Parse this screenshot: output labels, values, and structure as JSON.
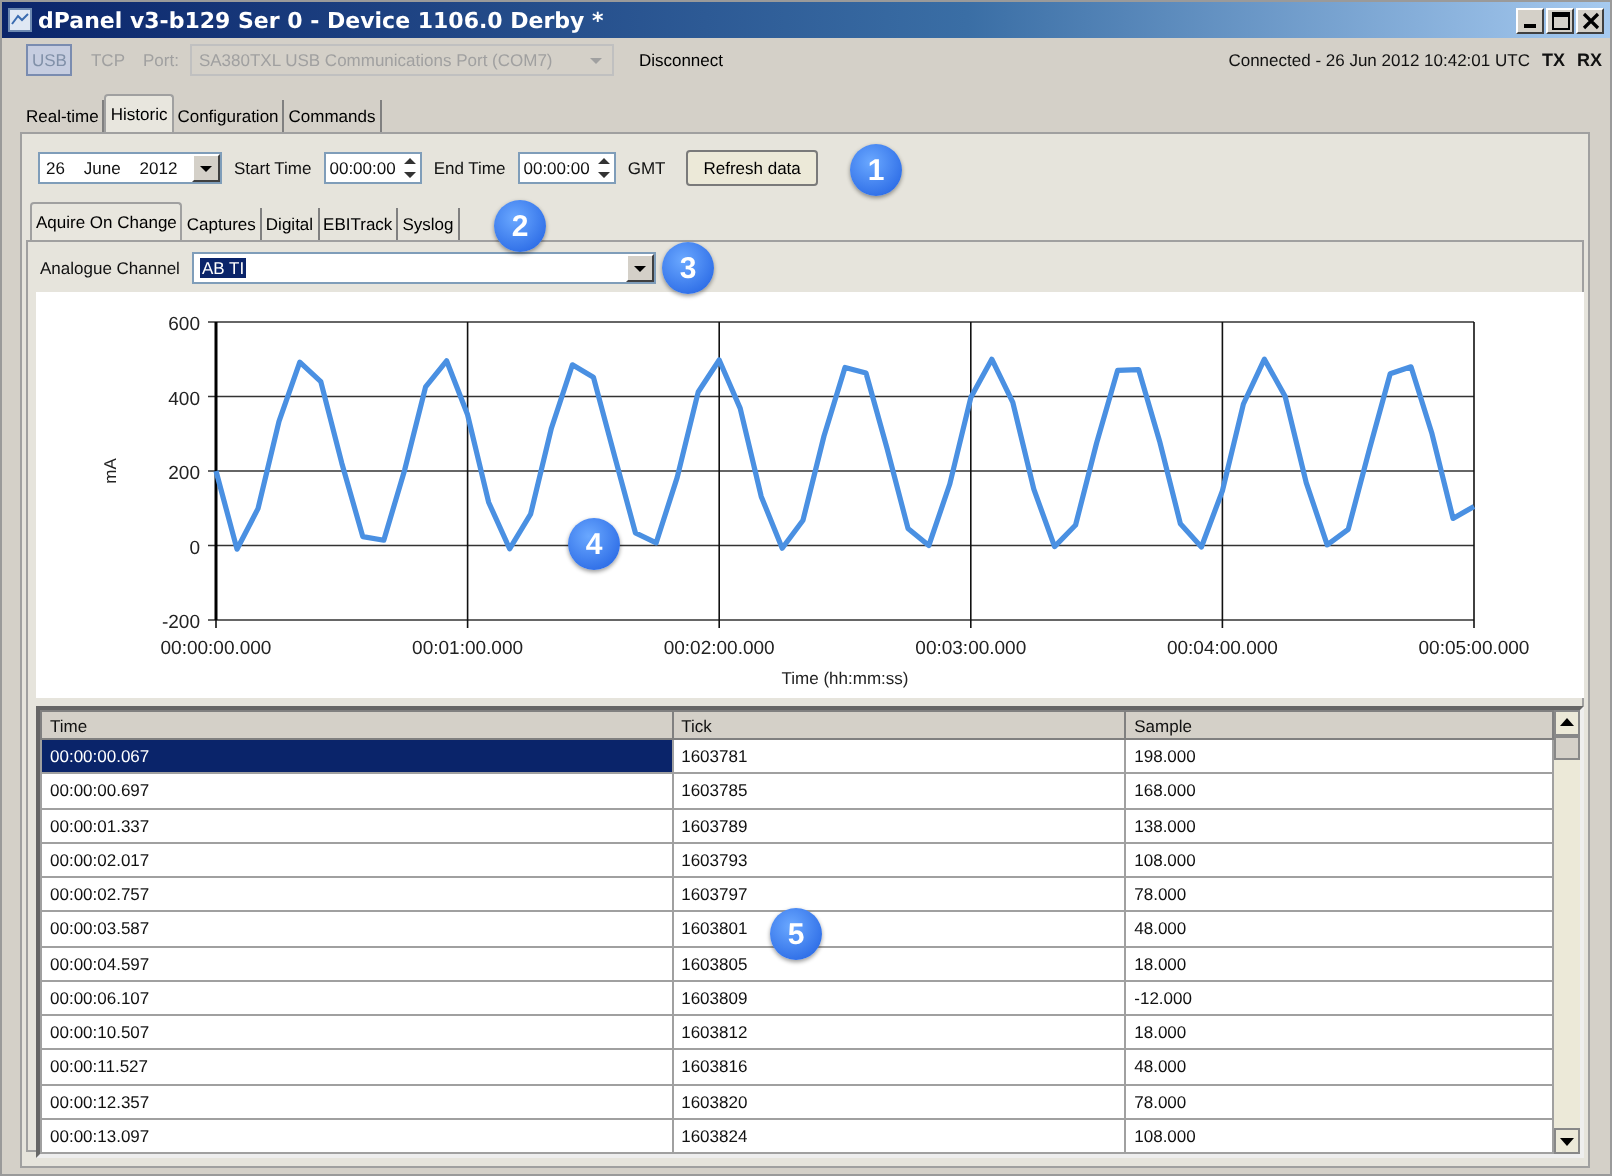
{
  "window": {
    "title": "dPanel v3-b129 Ser 0 - Device 1106.0 Derby  *"
  },
  "connection": {
    "modes": [
      {
        "label": "USB",
        "selected": true
      },
      {
        "label": "TCP",
        "selected": false
      }
    ],
    "port_label": "Port:",
    "port": {
      "value": "SA380TXL USB Communications Port (COM7)",
      "disabled": true
    },
    "disconnect": "Disconnect",
    "status": "Connected - 26 Jun 2012 10:42:01 UTC",
    "indicators": [
      "TX",
      "RX"
    ]
  },
  "tabs": [
    {
      "label": "Real-time",
      "selected": false
    },
    {
      "label": "Historic",
      "selected": true
    },
    {
      "label": "Configuration",
      "selected": false
    },
    {
      "label": "Commands",
      "selected": false
    }
  ],
  "query": {
    "date": "26    June    2012",
    "start_label": "Start Time",
    "start": "00:00:00",
    "end_label": "End Time",
    "end": "00:00:00",
    "zone": "GMT",
    "refresh": "Refresh data"
  },
  "subtabs": [
    {
      "label": "Aquire On Change",
      "selected": true
    },
    {
      "label": "Captures",
      "selected": false
    },
    {
      "label": "Digital",
      "selected": false
    },
    {
      "label": "EBITrack",
      "selected": false
    },
    {
      "label": "Syslog",
      "selected": false
    }
  ],
  "channel": {
    "label": "Analogue Channel",
    "value": "AB TI"
  },
  "chart_data": {
    "type": "line",
    "grid": true,
    "xlabel": "Time (hh:mm:ss)",
    "ylabel": "mA",
    "ylim": [
      -200,
      600
    ],
    "yticks": [
      -200,
      0,
      200,
      400,
      600
    ],
    "categories": [
      "00:00:00.000",
      null,
      null,
      null,
      null,
      null,
      null,
      null,
      null,
      null,
      null,
      null,
      "00:01:00.000",
      null,
      null,
      null,
      null,
      null,
      null,
      null,
      null,
      null,
      null,
      null,
      "00:02:00.000",
      null,
      null,
      null,
      null,
      null,
      null,
      null,
      null,
      null,
      null,
      null,
      "00:03:00.000",
      null,
      null,
      null,
      null,
      null,
      null,
      null,
      null,
      null,
      null,
      null,
      "00:04:00.000",
      null,
      null,
      null,
      null,
      null,
      null,
      null,
      null,
      null,
      null,
      null,
      "00:05:00.000"
    ],
    "series": [
      {
        "color": "#4a90e2",
        "values": [
          200,
          -10,
          99,
          333,
          492,
          440,
          221,
          24,
          14,
          202,
          426,
          496,
          351,
          116,
          -9,
          84,
          315,
          485,
          452,
          242,
          34,
          7,
          183,
          412,
          498,
          368,
          132,
          -7,
          68,
          294,
          478,
          463,
          261,
          46,
          0,
          165,
          397,
          500,
          384,
          151,
          -3,
          55,
          275,
          470,
          472,
          280,
          58,
          -4,
          147,
          380,
          500,
          400,
          169,
          2,
          43,
          256,
          461,
          480,
          300,
          73,
          105
        ]
      }
    ]
  },
  "table": {
    "columns": [
      "Time",
      "Tick",
      "Sample"
    ],
    "rows": [
      {
        "cells": [
          "00:00:00.067",
          "1603781",
          "198.000"
        ],
        "selected": true
      },
      {
        "cells": [
          "00:00:00.697",
          "1603785",
          "168.000"
        ],
        "selected": false
      },
      {
        "cells": [
          "00:00:01.337",
          "1603789",
          "138.000"
        ],
        "selected": false
      },
      {
        "cells": [
          "00:00:02.017",
          "1603793",
          "108.000"
        ],
        "selected": false
      },
      {
        "cells": [
          "00:00:02.757",
          "1603797",
          "78.000"
        ],
        "selected": false
      },
      {
        "cells": [
          "00:00:03.587",
          "1603801",
          "48.000"
        ],
        "selected": false
      },
      {
        "cells": [
          "00:00:04.597",
          "1603805",
          "18.000"
        ],
        "selected": false
      },
      {
        "cells": [
          "00:00:06.107",
          "1603809",
          "-12.000"
        ],
        "selected": false
      },
      {
        "cells": [
          "00:00:10.507",
          "1603812",
          "18.000"
        ],
        "selected": false
      },
      {
        "cells": [
          "00:00:11.527",
          "1603816",
          "48.000"
        ],
        "selected": false
      },
      {
        "cells": [
          "00:00:12.357",
          "1603820",
          "78.000"
        ],
        "selected": false
      },
      {
        "cells": [
          "00:00:13.097",
          "1603824",
          "108.000"
        ],
        "selected": false
      }
    ]
  },
  "callouts": [
    "1",
    "2",
    "3",
    "4",
    "5"
  ]
}
